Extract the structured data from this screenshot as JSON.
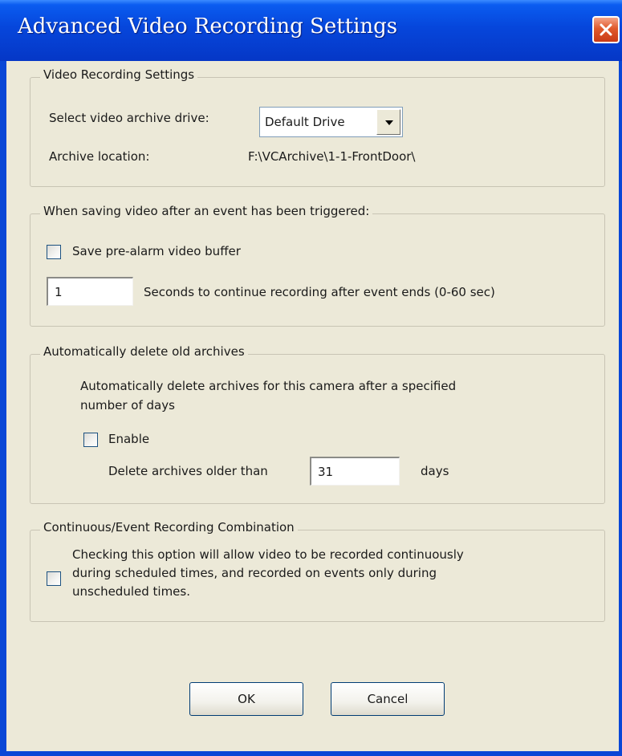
{
  "window": {
    "title": "Advanced Video Recording Settings",
    "close_icon": "close-x-icon",
    "title_bar_color": "#0646db",
    "close_button_color": "#e05a2c",
    "background": "#ece9d8"
  },
  "video_recording": {
    "legend": "Video Recording Settings",
    "drive_label": "Select video archive drive:",
    "drive_value": "Default Drive",
    "dropdown_icon": "chevron-down-icon",
    "location_label": "Archive location:",
    "location_value": "F:\\VCArchive\\1-1-FrontDoor\\"
  },
  "event_saving": {
    "legend": "When saving video after an event has been triggered:",
    "prealarm_label": "Save pre-alarm video buffer",
    "prealarm_checked": false,
    "seconds_value": "1",
    "seconds_label": "Seconds to continue recording after event ends (0-60 sec)"
  },
  "auto_delete": {
    "legend": "Automatically delete old archives",
    "description_line1": "Automatically delete archives for this camera after a specified",
    "description_line2": "number of days",
    "enable_label": "Enable",
    "enable_checked": false,
    "delete_label": "Delete archives older than",
    "days_value": "31",
    "days_unit": "days"
  },
  "combination": {
    "legend": "Continuous/Event Recording Combination",
    "option_line1": "Checking this option will allow video to be recorded continuously",
    "option_line2": "during scheduled times, and recorded on events only during",
    "option_line3": "unscheduled times.",
    "option_checked": false
  },
  "buttons": {
    "ok": "OK",
    "cancel": "Cancel"
  }
}
